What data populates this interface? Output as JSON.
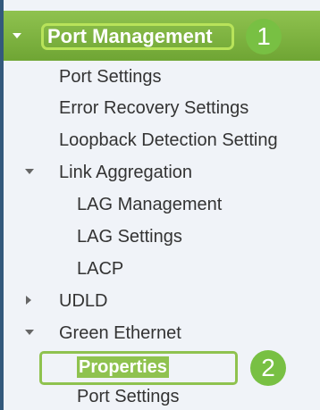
{
  "header": {
    "title": "Port Management"
  },
  "steps": {
    "first": "1",
    "second": "2"
  },
  "menu": {
    "port_settings": "Port Settings",
    "error_recovery": "Error Recovery Settings",
    "loopback_detection": "Loopback Detection Setting",
    "link_aggregation": "Link Aggregation",
    "lag_management": "LAG Management",
    "lag_settings": "LAG Settings",
    "lacp": "LACP",
    "udld": "UDLD",
    "green_ethernet": "Green Ethernet",
    "properties": "Properties",
    "green_port_settings": "Port Settings"
  },
  "colors": {
    "header_bg": "#7cb342",
    "highlight": "#8fc24f",
    "left_bar": "#33597c"
  }
}
